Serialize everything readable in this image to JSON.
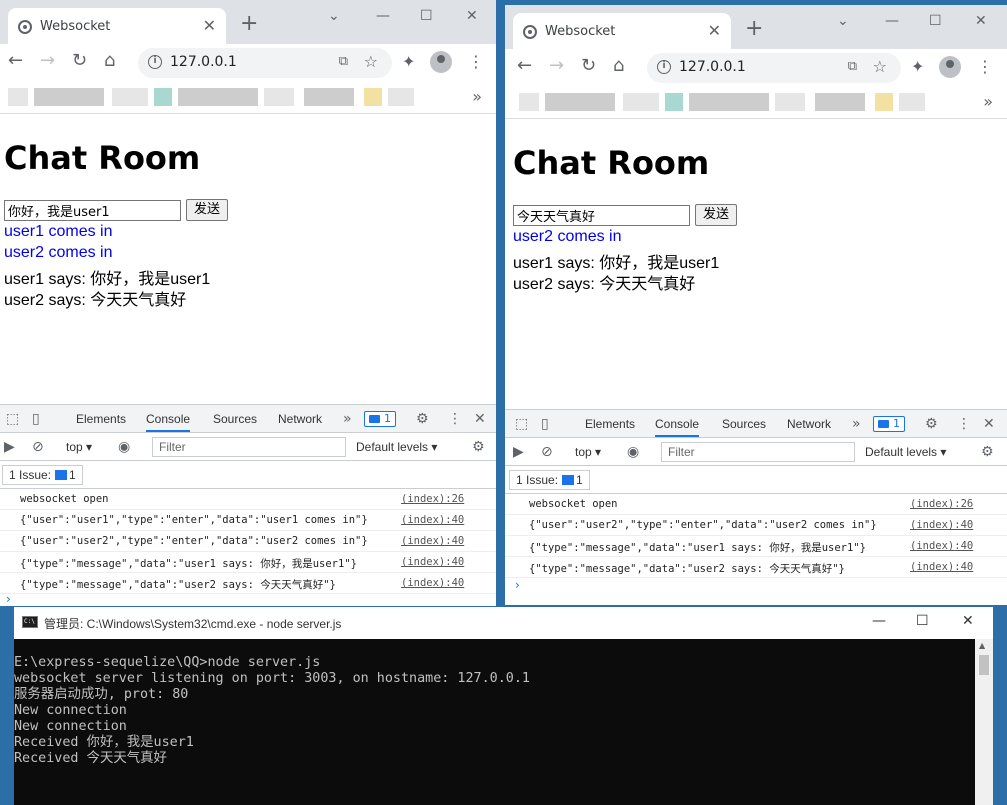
{
  "colors": {
    "link": "#0000ee",
    "accent": "#1a73e8",
    "terminal_bg": "#0c0c0c",
    "terminal_fg": "#c0c0c0"
  },
  "browser1": {
    "tab_title": "Websocket",
    "url": "127.0.0.1",
    "page_title": "Chat Room",
    "input_value": "你好，我是user1",
    "send_label": "发送",
    "messages": [
      {
        "text": "user1 comes in",
        "kind": "enter"
      },
      {
        "text": "user2 comes in",
        "kind": "enter"
      },
      {
        "text": "user1 says: 你好，我是user1",
        "kind": "message"
      },
      {
        "text": "user2 says: 今天天气真好",
        "kind": "message"
      }
    ],
    "devtools": {
      "tabs": [
        "Elements",
        "Console",
        "Sources",
        "Network"
      ],
      "active_tab": "Console",
      "badge_count": "1",
      "context": "top",
      "filter_placeholder": "Filter",
      "levels": "Default levels",
      "issues_label": "1 Issue:",
      "issues_count": "1",
      "logs": [
        {
          "text": "websocket open",
          "src": "(index):26"
        },
        {
          "text": "{\"user\":\"user1\",\"type\":\"enter\",\"data\":\"user1 comes in\"}",
          "src": "(index):40"
        },
        {
          "text": "{\"user\":\"user2\",\"type\":\"enter\",\"data\":\"user2 comes in\"}",
          "src": "(index):40"
        },
        {
          "text": "{\"type\":\"message\",\"data\":\"user1 says: 你好，我是user1\"}",
          "src": "(index):40"
        },
        {
          "text": "{\"type\":\"message\",\"data\":\"user2 says: 今天天气真好\"}",
          "src": "(index):40"
        }
      ]
    }
  },
  "browser2": {
    "tab_title": "Websocket",
    "url": "127.0.0.1",
    "page_title": "Chat Room",
    "input_value": "今天天气真好",
    "send_label": "发送",
    "messages": [
      {
        "text": "user2 comes in",
        "kind": "enter"
      },
      {
        "text": "user1 says: 你好，我是user1",
        "kind": "message"
      },
      {
        "text": "user2 says: 今天天气真好",
        "kind": "message"
      }
    ],
    "devtools": {
      "tabs": [
        "Elements",
        "Console",
        "Sources",
        "Network"
      ],
      "active_tab": "Console",
      "badge_count": "1",
      "context": "top",
      "filter_placeholder": "Filter",
      "levels": "Default levels",
      "issues_label": "1 Issue:",
      "issues_count": "1",
      "logs": [
        {
          "text": "websocket open",
          "src": "(index):26"
        },
        {
          "text": "{\"user\":\"user2\",\"type\":\"enter\",\"data\":\"user2 comes in\"}",
          "src": "(index):40"
        },
        {
          "text": "{\"type\":\"message\",\"data\":\"user1 says: 你好，我是user1\"}",
          "src": "(index):40"
        },
        {
          "text": "{\"type\":\"message\",\"data\":\"user2 says: 今天天气真好\"}",
          "src": "(index):40"
        }
      ]
    }
  },
  "cmd": {
    "title": "管理员: C:\\Windows\\System32\\cmd.exe - node  server.js",
    "lines": [
      "E:\\express-sequelize\\QQ>node server.js",
      "websocket server listening on port: 3003, on hostname: 127.0.0.1",
      "服务器启动成功, prot: 80",
      "New connection",
      "New connection",
      "Received 你好，我是user1",
      "Received 今天天气真好"
    ]
  }
}
